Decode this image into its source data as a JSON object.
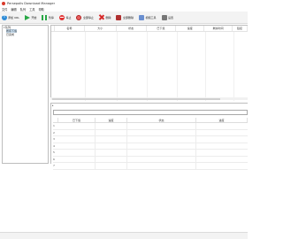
{
  "window": {
    "title": "Persepolis Download Manager"
  },
  "menu": [
    "文件",
    "编辑",
    "队列",
    "工具",
    "帮助"
  ],
  "toolbar": {
    "add_label": "添加 URL",
    "start_label": "开始",
    "pause_label": "暂停",
    "stop_label": "停止",
    "stop_all_label": "全部停止",
    "delete_label": "删除",
    "delete_all_label": "全部删除",
    "manager_label": "视频工具",
    "settings_label": "设置"
  },
  "tree": {
    "root": "队列",
    "items": [
      "所有下载",
      "已完成"
    ]
  },
  "download_table": {
    "columns": [
      "",
      "名称",
      "大小",
      "状态",
      "已下载",
      "速度",
      "剩余时间",
      "链接"
    ]
  },
  "segments": {
    "columns": [
      "已下载",
      "速度",
      "状态",
      "进度"
    ],
    "rows": [
      "1",
      "2",
      "3",
      "4",
      "5",
      "6",
      "7"
    ]
  },
  "colors": {
    "accent_blue": "#2d8bd6",
    "start_green": "#28a745",
    "stop_red": "#e03131"
  }
}
